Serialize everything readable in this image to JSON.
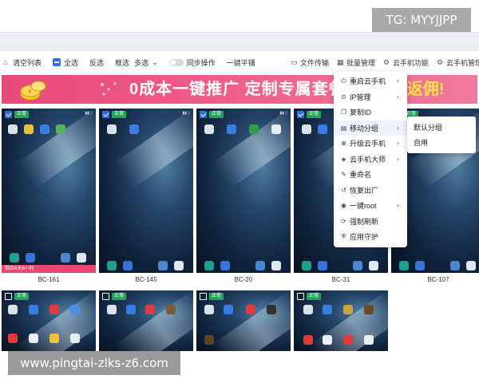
{
  "watermarks": {
    "top": "TG: MYYJJPP",
    "bottom": "www.pingtai-zlks-z6.com"
  },
  "toolbar": {
    "clear_list": "清空列表",
    "select_all": "全选",
    "invert": "反选",
    "box_select": "框选",
    "multi_select": "多选",
    "sync_op": "同步操作",
    "tile": "一键平铺",
    "file_transfer": "文件传输",
    "batch_manage": "批量管理",
    "cloud_func": "云手机功能",
    "cloud_manage": "云手机管理"
  },
  "banner": {
    "text": "0成本一键推广  定制专属套餐",
    "text_right": "%返佣!"
  },
  "context_menu": {
    "items": [
      {
        "label": "重启云手机",
        "icon": "power-icon",
        "glyph": "⏻",
        "has_submenu": true
      },
      {
        "label": "IP管理",
        "icon": "location-pin-icon",
        "glyph": "⊙",
        "has_submenu": true
      },
      {
        "label": "复制ID",
        "icon": "copy-icon",
        "glyph": "❐",
        "has_submenu": false
      },
      {
        "label": "移动分组",
        "icon": "folder-move-icon",
        "glyph": "▤",
        "has_submenu": true
      },
      {
        "label": "升级云手机",
        "icon": "upgrade-icon",
        "glyph": "⊕",
        "has_submenu": true
      },
      {
        "label": "云手机大师",
        "icon": "master-icon",
        "glyph": "◈",
        "has_submenu": true
      },
      {
        "label": "重命名",
        "icon": "edit-icon",
        "glyph": "✎",
        "has_submenu": false
      },
      {
        "label": "恢复出厂",
        "icon": "restore-icon",
        "glyph": "↺",
        "has_submenu": false
      },
      {
        "label": "一键root",
        "icon": "root-icon",
        "glyph": "◉",
        "has_submenu": true
      },
      {
        "label": "强制刷新",
        "icon": "refresh-icon",
        "glyph": "⟳",
        "has_submenu": false
      },
      {
        "label": "应用守护",
        "icon": "shield-icon",
        "glyph": "⛨",
        "has_submenu": false
      }
    ],
    "submenu": [
      "默认分组",
      "自用"
    ]
  },
  "phones_row1": [
    {
      "label": "BC-161",
      "status": "正常",
      "checked": true,
      "remain": "剩余6天6小时"
    },
    {
      "label": "BC-145",
      "status": "正常",
      "checked": true
    },
    {
      "label": "BC-20",
      "status": "正常",
      "checked": true
    },
    {
      "label": "BC-31",
      "status": "正常",
      "checked": true
    },
    {
      "label": "BC-107",
      "status": "正常",
      "checked": true
    }
  ],
  "phones_row2": [
    {
      "status": "正常",
      "checked": false
    },
    {
      "status": "正常",
      "checked": false
    },
    {
      "status": "正常",
      "checked": false
    },
    {
      "status": "正常",
      "checked": false
    }
  ],
  "colors": {
    "accent": "#2f6fde",
    "status_ok": "#25a55a",
    "banner": "#e84a78",
    "remain": "#e8486e"
  }
}
